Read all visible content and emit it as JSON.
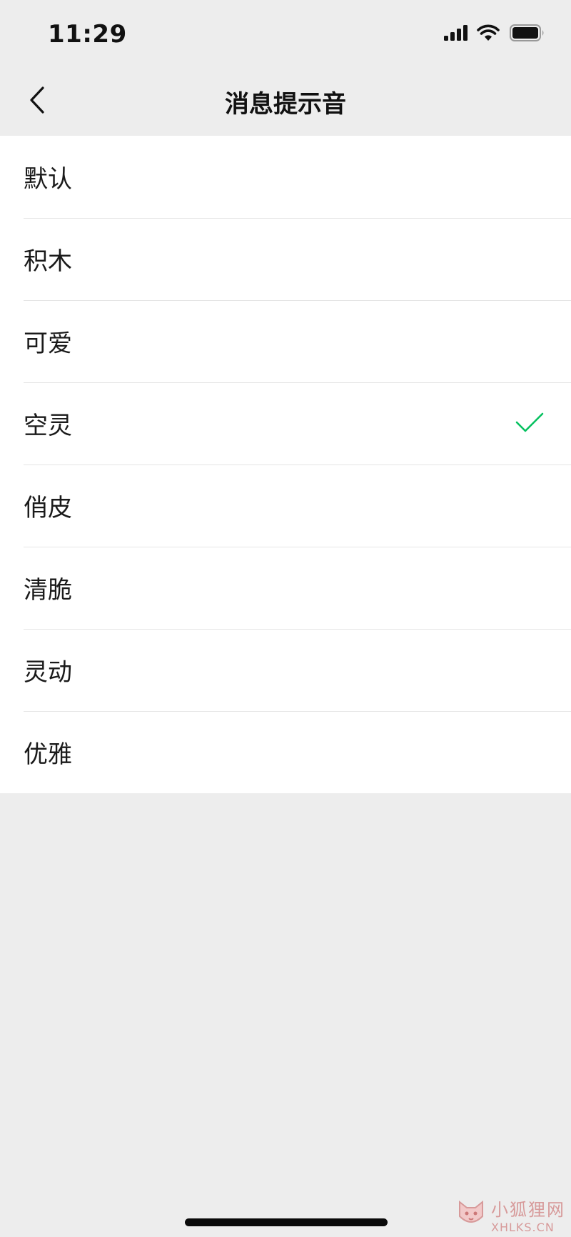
{
  "status_bar": {
    "time": "11:29"
  },
  "nav": {
    "title": "消息提示音",
    "back_icon": "chevron-left-icon"
  },
  "sounds": {
    "selected": "空灵",
    "items": [
      {
        "label": "默认"
      },
      {
        "label": "积木"
      },
      {
        "label": "可爱"
      },
      {
        "label": "空灵"
      },
      {
        "label": "俏皮"
      },
      {
        "label": "清脆"
      },
      {
        "label": "灵动"
      },
      {
        "label": "优雅"
      }
    ]
  },
  "watermark": {
    "name": "小狐狸网",
    "domain": "XHLKS.CN"
  },
  "colors": {
    "background": "#ededed",
    "list_background": "#ffffff",
    "check": "#07c160",
    "divider": "#e5e5e5",
    "watermark": "#d79a9a"
  }
}
